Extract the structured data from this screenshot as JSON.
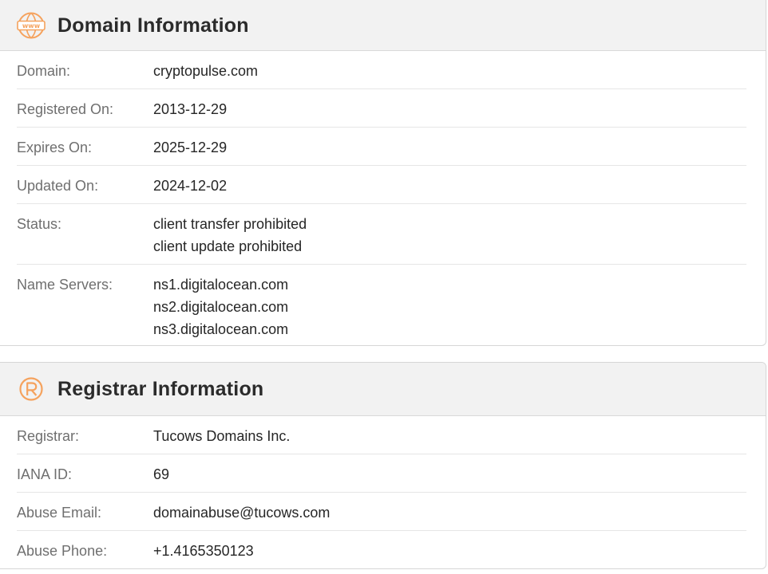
{
  "domain_section": {
    "title": "Domain Information",
    "icon": "www-globe-icon",
    "rows": {
      "domain": {
        "label": "Domain:",
        "value": "cryptopulse.com"
      },
      "registered": {
        "label": "Registered On:",
        "value": "2013-12-29"
      },
      "expires": {
        "label": "Expires On:",
        "value": "2025-12-29"
      },
      "updated": {
        "label": "Updated On:",
        "value": "2024-12-02"
      },
      "status": {
        "label": "Status:",
        "values": [
          "client transfer prohibited",
          "client update prohibited"
        ]
      },
      "nameservers": {
        "label": "Name Servers:",
        "values": [
          "ns1.digitalocean.com",
          "ns2.digitalocean.com",
          "ns3.digitalocean.com"
        ]
      }
    }
  },
  "registrar_section": {
    "title": "Registrar Information",
    "icon": "registered-trademark-icon",
    "rows": {
      "registrar": {
        "label": "Registrar:",
        "value": "Tucows Domains Inc."
      },
      "iana": {
        "label": "IANA ID:",
        "value": "69"
      },
      "abuse_email": {
        "label": "Abuse Email:",
        "value": "domainabuse@tucows.com"
      },
      "abuse_phone": {
        "label": "Abuse Phone:",
        "value": "+1.4165350123"
      }
    }
  },
  "colors": {
    "accent_icon": "#f5a25d",
    "header_bg": "#f2f2f2",
    "label_text": "#6f6f6f",
    "value_text": "#262626"
  }
}
